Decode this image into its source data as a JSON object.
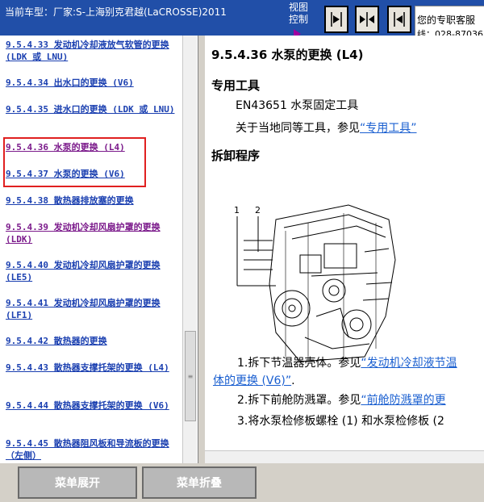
{
  "header": {
    "car_label": "当前车型：厂家:S-上海别克君越(LaCROSSE)2011",
    "view_control_line1": "视图",
    "view_control_line2": "控制",
    "service_line1": "您的专职客服",
    "service_line2": "线：028-87036"
  },
  "toolbar_icons": [
    "expand-right-icon",
    "split-view-icon",
    "expand-left-icon"
  ],
  "nav": {
    "items": [
      {
        "label": "9.5.4.33 发动机冷却液放气软管的更换 (LDK 或 LNU)",
        "visited": false
      },
      {
        "label": "9.5.4.34 出水口的更换 (V6)",
        "visited": false
      },
      {
        "label": "9.5.4.35 进水口的更换 (LDK 或 LNU)",
        "visited": false
      },
      {
        "label": "9.5.4.36 水泵的更换 (L4)",
        "visited": true
      },
      {
        "label": "9.5.4.37 水泵的更换 (V6)",
        "visited": false
      },
      {
        "label": "9.5.4.38 散热器排放塞的更换",
        "visited": false
      },
      {
        "label": "9.5.4.39 发动机冷却风扇护罩的更换 (LDK)",
        "visited": true
      },
      {
        "label": "9.5.4.40 发动机冷却风扇护罩的更换 (LE5)",
        "visited": false
      },
      {
        "label": "9.5.4.41 发动机冷却风扇护罩的更换 (LF1)",
        "visited": false
      },
      {
        "label": "9.5.4.42 散热器的更换",
        "visited": false
      },
      {
        "label": "9.5.4.43 散热器支撑托架的更换 (L4)",
        "visited": false
      },
      {
        "label": "9.5.4.44 散热器支撑托架的更换 (V6)",
        "visited": false
      },
      {
        "label": "9.5.4.45 散热器阻风板和导流板的更换（左侧）",
        "visited": false
      }
    ]
  },
  "document": {
    "title": "9.5.4.36 水泵的更换 (L4)",
    "tools_heading": "专用工具",
    "tool_item": "EN43651 水泵固定工具",
    "see_prefix": "关于当地同等工具，参见",
    "see_link": "“专用工具”",
    "procedure_heading": "拆卸程序",
    "figure_callouts": [
      "1",
      "2"
    ],
    "step1_prefix": "1.拆下节温器壳体。参见",
    "step1_link": "“发动机冷却液节温",
    "step1_link_cont": "体的更换 (V6)”",
    "step1_suffix": ".",
    "step2_prefix": "2.拆下前舱防溅罩。参见",
    "step2_link": "“前舱防溅罩的更",
    "step3": "3.将水泵检修板螺栓 (1) 和水泵检修板 (2"
  },
  "bottom": {
    "expand_label": "菜单展开",
    "collapse_label": "菜单折叠"
  }
}
